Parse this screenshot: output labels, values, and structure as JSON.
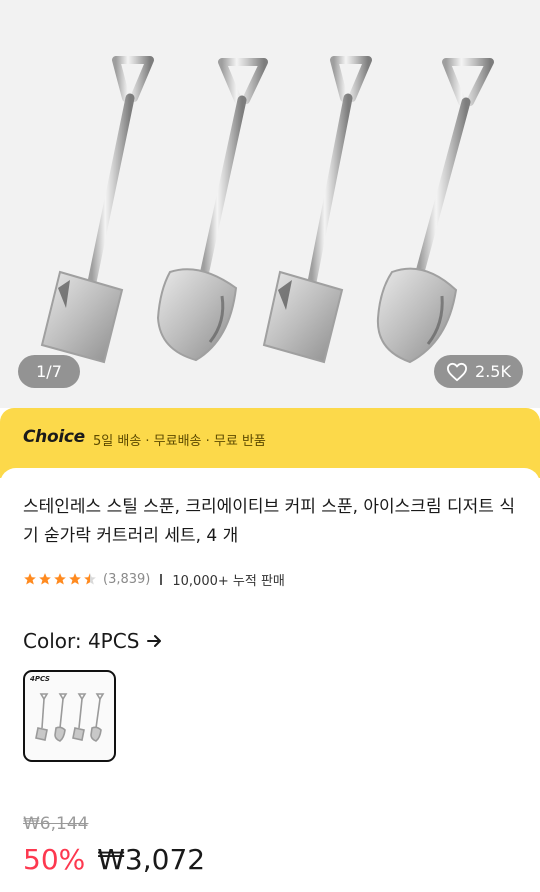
{
  "gallery": {
    "counter": "1/7",
    "likes": "2.5K",
    "heart_icon": "heart-outline-icon"
  },
  "choice": {
    "logo": "Choice",
    "text": "5일 배송 · 무료배송 · 무료 반품",
    "color": "#fcd94a"
  },
  "product": {
    "title": "스테인레스 스틸 스푼, 크리에이티브 커피 스푼, 아이스크림 디저트 식기 숟가락 커트러리 세트, 4 개",
    "rating_stars": 4.5,
    "review_count": "(3,839)",
    "sold": "10,000+ 누적 판매",
    "star_color": "#ff8a1f"
  },
  "variant": {
    "color_label": "Color: 4PCS",
    "arrow_icon": "arrow-right-icon",
    "swatch_label": "4PCS"
  },
  "pricing": {
    "original": "₩6,144",
    "discount": "50%",
    "price": "₩3,072",
    "discount_color": "#fd384f"
  }
}
